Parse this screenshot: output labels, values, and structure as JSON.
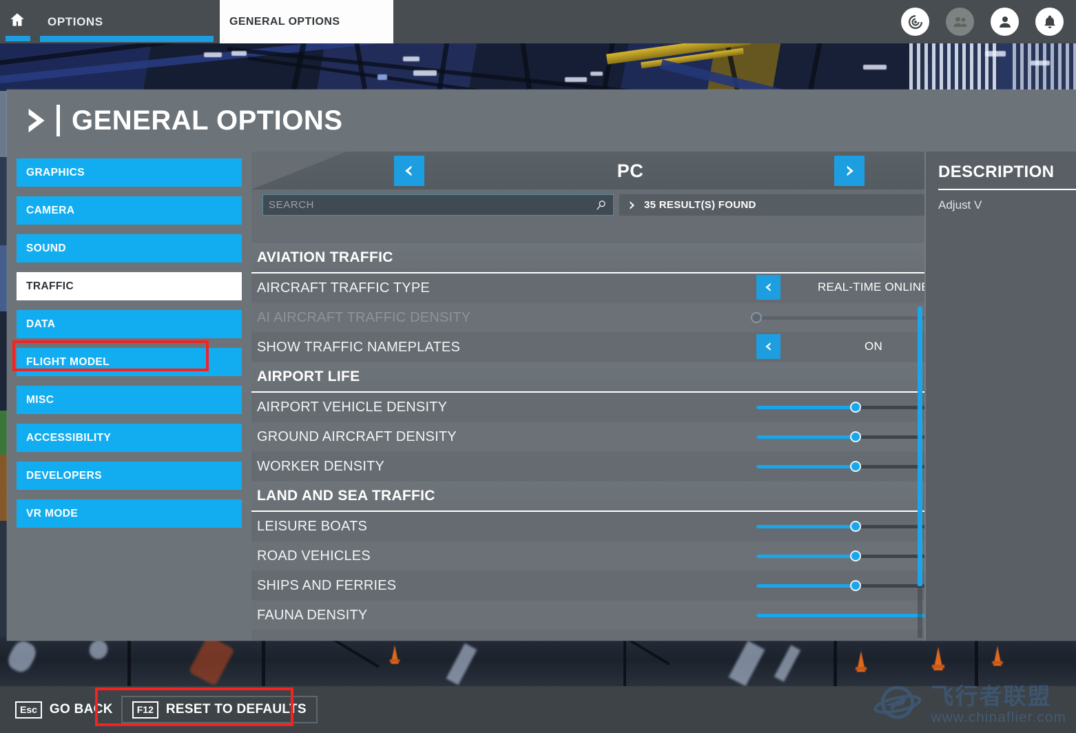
{
  "topbar": {
    "home_icon": "home-icon",
    "tabs": [
      {
        "label": "OPTIONS",
        "active": true
      },
      {
        "label": "GENERAL OPTIONS",
        "active": false
      }
    ],
    "icons": [
      {
        "name": "radar-icon"
      },
      {
        "name": "friends-icon"
      },
      {
        "name": "profile-icon"
      },
      {
        "name": "notifications-bell-icon"
      }
    ]
  },
  "page": {
    "title": "GENERAL OPTIONS",
    "back_chevron_icon": "chevron-right-icon"
  },
  "sidebar": {
    "items": [
      {
        "label": "GRAPHICS",
        "selected": false
      },
      {
        "label": "CAMERA",
        "selected": false
      },
      {
        "label": "SOUND",
        "selected": false
      },
      {
        "label": "TRAFFIC",
        "selected": true
      },
      {
        "label": "DATA",
        "selected": false
      },
      {
        "label": "FLIGHT MODEL",
        "selected": false
      },
      {
        "label": "MISC",
        "selected": false
      },
      {
        "label": "ACCESSIBILITY",
        "selected": false
      },
      {
        "label": "DEVELOPERS",
        "selected": false
      },
      {
        "label": "VR MODE",
        "selected": false
      }
    ]
  },
  "platform": {
    "name": "PC",
    "prev_icon": "chevron-left-icon",
    "next_icon": "chevron-right-icon"
  },
  "search": {
    "value": "",
    "placeholder": "SEARCH",
    "icon": "search-magnifier-icon",
    "results_text": "35 RESULT(S) FOUND",
    "results_icon": "chevron-right-icon"
  },
  "settings": [
    {
      "section": "AVIATION TRAFFIC",
      "rows": [
        {
          "label": "AIRCRAFT TRAFFIC TYPE",
          "type": "enum",
          "value": "REAL-TIME ONLINE",
          "disabled": false
        },
        {
          "label": "AI AIRCRAFT TRAFFIC DENSITY",
          "type": "slider",
          "value": 0,
          "max": 100,
          "disabled": true
        },
        {
          "label": "SHOW TRAFFIC NAMEPLATES",
          "type": "enum",
          "value": "ON",
          "disabled": false
        }
      ]
    },
    {
      "section": "AIRPORT LIFE",
      "rows": [
        {
          "label": "AIRPORT VEHICLE DENSITY",
          "type": "slider",
          "value": 50,
          "max": 100,
          "disabled": false
        },
        {
          "label": "GROUND AIRCRAFT DENSITY",
          "type": "slider",
          "value": 50,
          "max": 100,
          "disabled": false
        },
        {
          "label": "WORKER DENSITY",
          "type": "slider",
          "value": 50,
          "max": 100,
          "disabled": false
        }
      ]
    },
    {
      "section": "LAND AND SEA TRAFFIC",
      "rows": [
        {
          "label": "LEISURE BOATS",
          "type": "slider",
          "value": 50,
          "max": 100,
          "disabled": false
        },
        {
          "label": "ROAD VEHICLES",
          "type": "slider",
          "value": 50,
          "max": 100,
          "disabled": false
        },
        {
          "label": "SHIPS AND FERRIES",
          "type": "slider",
          "value": 50,
          "max": 100,
          "disabled": false
        },
        {
          "label": "FAUNA DENSITY",
          "type": "slider",
          "value": 100,
          "max": 100,
          "disabled": false
        }
      ]
    }
  ],
  "description": {
    "title": "DESCRIPTION",
    "text": "Adjust V"
  },
  "bottombar": {
    "hints": [
      {
        "key": "Esc",
        "label": "GO BACK",
        "highlighted": false
      },
      {
        "key": "F12",
        "label": "RESET TO DEFAULTS",
        "highlighted": true
      }
    ]
  },
  "watermark": {
    "cn": "飞行者联盟",
    "url": "www.chinaflier.com",
    "logo_icon": "airplane-globe-logo-icon"
  },
  "colors": {
    "accent_blue": "#12adf0",
    "button_blue": "#1c9ee0",
    "annotation_red": "#f52222",
    "panel_gray": "#6d7479"
  }
}
